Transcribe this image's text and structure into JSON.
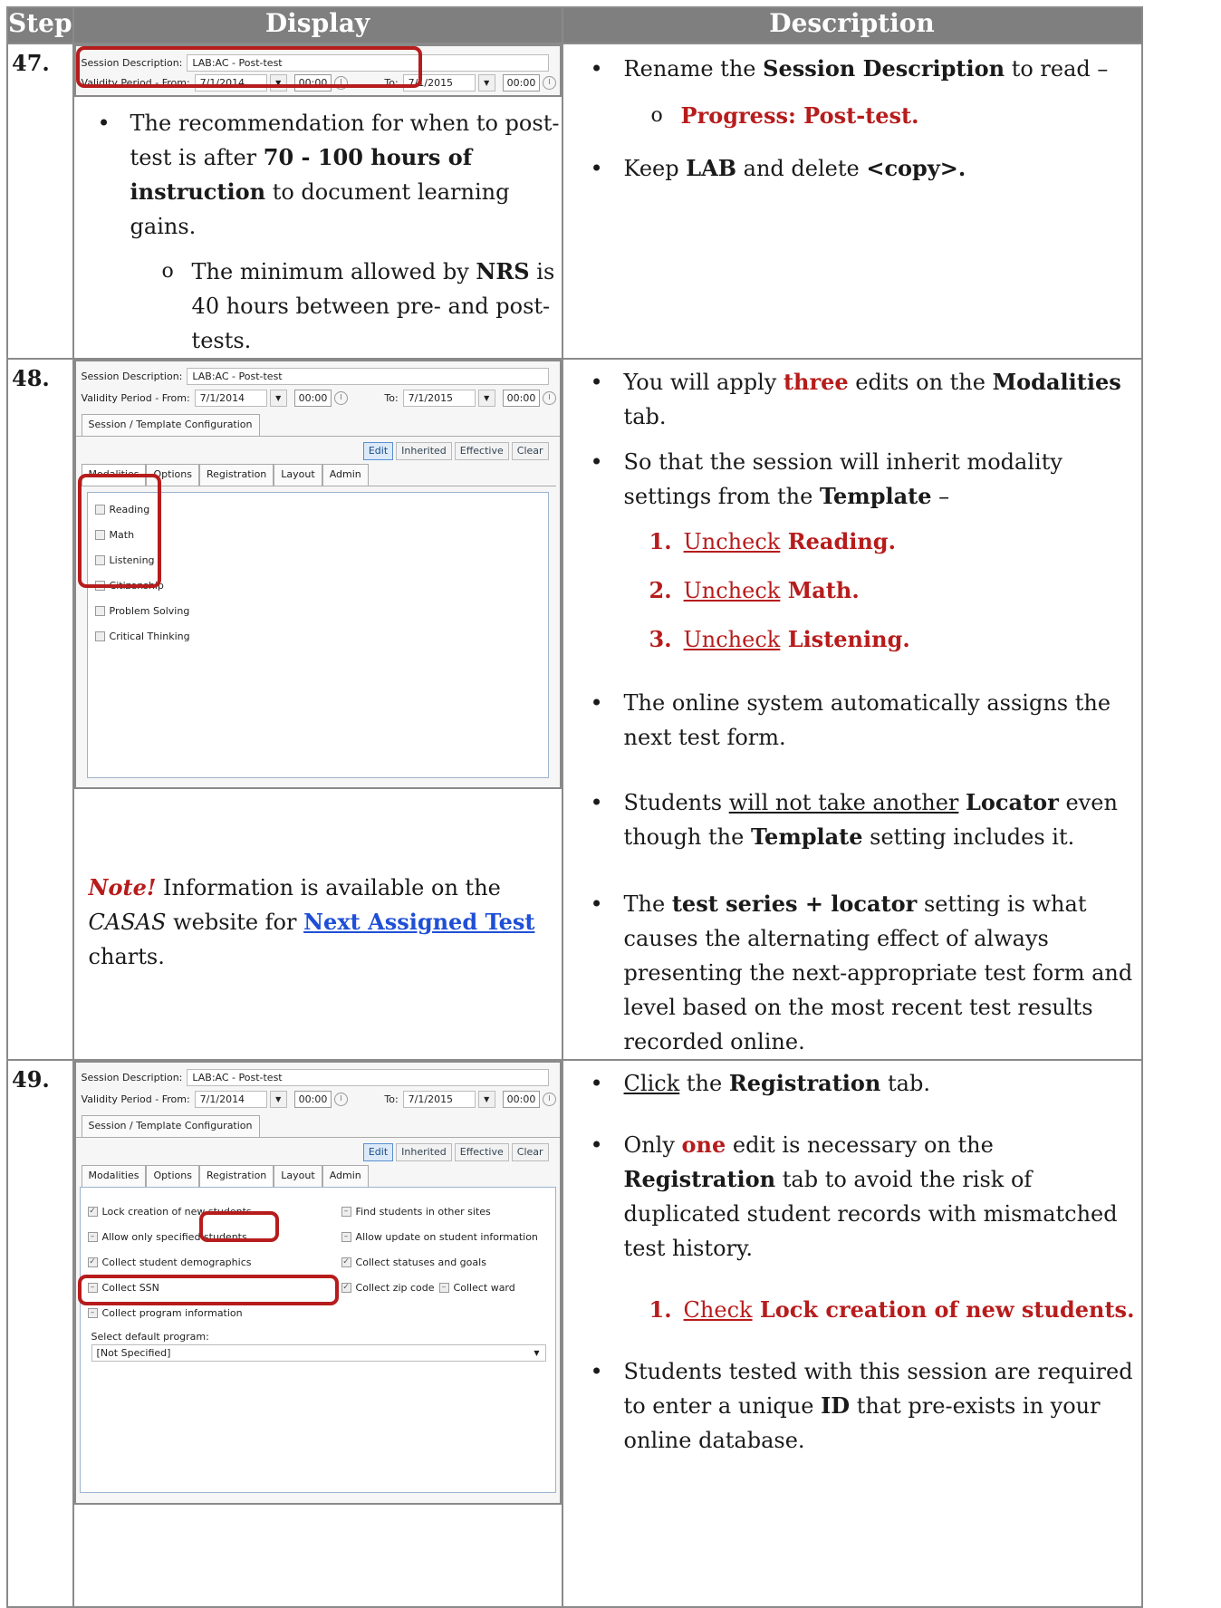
{
  "header": {
    "step": "Step",
    "display": "Display",
    "description": "Description"
  },
  "steps": [
    {
      "num": "47.",
      "screenshot": {
        "session_label": "Session Description:",
        "session_value": "LAB:AC - Post-test",
        "validity_label": "Validity Period - From:",
        "from_date": "7/1/2014",
        "from_time": "00:00",
        "to_label": "To:",
        "to_date": "7/1/2015",
        "to_time": "00:00"
      },
      "display_bullet_a": "The recommendation for when to post-test is after ",
      "display_bullet_b": "70 - 100 hours of instruction",
      "display_bullet_c": " to document learning gains.",
      "display_sub_a": "The minimum allowed by ",
      "display_sub_b": "NRS",
      "display_sub_c": " is 40 hours between pre- and post-tests.",
      "desc_b1_a": "Rename the ",
      "desc_b1_b": "Session Description",
      "desc_b1_c": " to read –",
      "desc_sub": "Progress: Post-test.",
      "desc_b2_a": "Keep ",
      "desc_b2_b": "LAB",
      "desc_b2_c": " and delete ",
      "desc_b2_d": "<copy>."
    },
    {
      "num": "48.",
      "screenshot": {
        "session_label": "Session Description:",
        "session_value": "LAB:AC - Post-test",
        "validity_label": "Validity Period - From:",
        "from_date": "7/1/2014",
        "from_time": "00:00",
        "to_label": "To:",
        "to_date": "7/1/2015",
        "to_time": "00:00",
        "config_tab": "Session / Template Configuration",
        "buttons": [
          "Edit",
          "Inherited",
          "Effective",
          "Clear"
        ],
        "tabs": [
          "Modalities",
          "Options",
          "Registration",
          "Layout",
          "Admin"
        ],
        "checkboxes": [
          "Reading",
          "Math",
          "Listening",
          "Citizenship",
          "Problem Solving",
          "Critical Thinking"
        ]
      },
      "note_label": "Note!",
      "note_a": " Information is available on the ",
      "note_casas": "CASAS",
      "note_b": " website for ",
      "note_link": "Next Assigned Test",
      "note_c": " charts.",
      "b1_a": "You will apply ",
      "b1_b": "three",
      "b1_c": " edits on the ",
      "b1_d": "Modalities",
      "b1_e": " tab.",
      "b2_a": "So that the session will inherit modality settings from the ",
      "b2_b": "Template",
      "b2_c": " –",
      "numbered": [
        {
          "n": "1.",
          "verb": "Uncheck",
          "obj": "Reading."
        },
        {
          "n": "2.",
          "verb": "Uncheck",
          "obj": "Math."
        },
        {
          "n": "3.",
          "verb": "Uncheck",
          "obj": "Listening."
        }
      ],
      "b3": "The online system automatically assigns the next test form.",
      "b4_a": "Students ",
      "b4_b": "will not take another",
      "b4_c": " ",
      "b4_d": "Locator",
      "b4_e": " even though the ",
      "b4_f": "Template",
      "b4_g": " setting includes it.",
      "b5_a": "The ",
      "b5_b": "test series + locator",
      "b5_c": " setting is what causes the alternating effect of always presenting the next-appropriate test form and level based on the most recent test results recorded online."
    },
    {
      "num": "49.",
      "screenshot": {
        "session_label": "Session Description:",
        "session_value": "LAB:AC - Post-test",
        "validity_label": "Validity Period - From:",
        "from_date": "7/1/2014",
        "from_time": "00:00",
        "to_label": "To:",
        "to_date": "7/1/2015",
        "to_time": "00:00",
        "config_tab": "Session / Template Configuration",
        "buttons": [
          "Edit",
          "Inherited",
          "Effective",
          "Clear"
        ],
        "tabs": [
          "Modalities",
          "Options",
          "Registration",
          "Layout",
          "Admin"
        ],
        "left_checks": [
          "Lock creation of new students",
          "Allow only specified students",
          "Collect student demographics",
          "Collect SSN",
          "Collect program information"
        ],
        "right_checks": [
          "Find students in other sites",
          "Allow update on student information",
          "Collect statuses and goals",
          "Collect zip code",
          "Collect ward"
        ],
        "program_label": "Select default program:",
        "program_value": "[Not Specified]"
      },
      "b1_a": "Click",
      "b1_b": " the ",
      "b1_c": "Registration",
      "b1_d": " tab.",
      "b2_a": "Only ",
      "b2_b": "one",
      "b2_c": " edit is necessary on the ",
      "b2_d": "Registration",
      "b2_e": " tab to avoid the risk of duplicated student records with mismatched test history.",
      "num1_n": "1.",
      "num1_verb": "Check",
      "num1_obj": "Lock creation of new students.",
      "b3_a": "Students tested with this session are required to enter a unique ",
      "b3_b": "ID",
      "b3_c": " that pre-exists in your online database."
    }
  ]
}
